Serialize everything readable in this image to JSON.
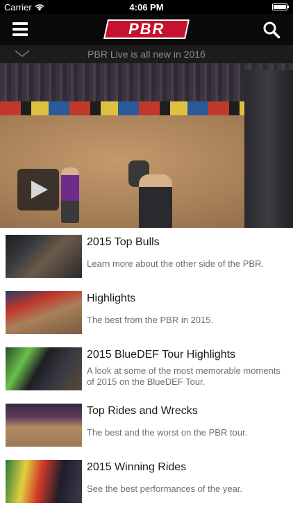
{
  "status_bar": {
    "carrier": "Carrier",
    "time": "4:06 PM"
  },
  "nav": {
    "logo_text": "PBR",
    "menu_icon": "hamburger-menu-icon",
    "search_icon": "search-icon"
  },
  "banner": {
    "text": "PBR Live is all new in 2016",
    "icon": "chevron-down-icon"
  },
  "video": {
    "play_icon": "play-icon"
  },
  "videos": [
    {
      "title": "2015 Top Bulls",
      "description": "Learn more about the other side of the PBR."
    },
    {
      "title": "Highlights",
      "description": "The best from the PBR in 2015."
    },
    {
      "title": "2015 BlueDEF Tour Highlights",
      "description": "A look at some of the most memorable moments of 2015 on the BlueDEF Tour."
    },
    {
      "title": "Top Rides and Wrecks",
      "description": "The best and the worst on the PBR tour."
    },
    {
      "title": "2015 Winning Rides",
      "description": "See the best performances of the year."
    }
  ],
  "colors": {
    "brand_red": "#c41230",
    "nav_background": "#0a0a0a",
    "banner_background": "#1c1c1c"
  }
}
